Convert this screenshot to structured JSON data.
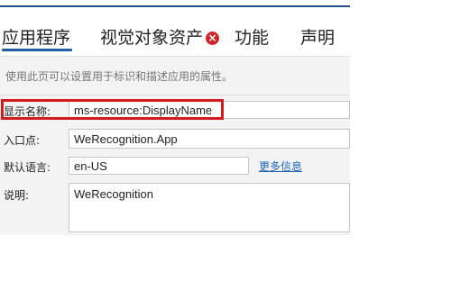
{
  "tabs": [
    {
      "label": "应用程序",
      "active": true
    },
    {
      "label": "视觉对象资产",
      "has_error": true
    },
    {
      "label": "功能"
    },
    {
      "label": "声明"
    }
  ],
  "description": "使用此页可以设置用于标识和描述应用的属性。",
  "fields": {
    "display_name": {
      "label": "显示名称:",
      "value": "ms-resource:DisplayName"
    },
    "entry_point": {
      "label": "入口点:",
      "value": "WeRecognition.App"
    },
    "default_language": {
      "label": "默认语言:",
      "value": "en-US",
      "link": "更多信息"
    },
    "description": {
      "label": "说明:",
      "value": "WeRecognition"
    }
  },
  "colors": {
    "highlight": "#d21c1c",
    "tab_underline": "#1e5fa8",
    "link": "#1f63b8",
    "error_icon": "#cc2a2a"
  },
  "icons": {
    "tab_error": "error-x-icon",
    "error_glyph": "×"
  }
}
